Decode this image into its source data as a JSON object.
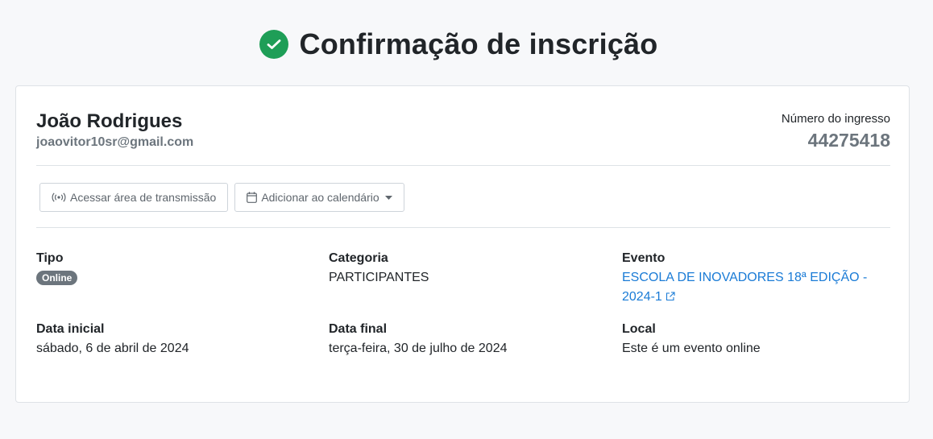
{
  "header": {
    "title": "Confirmação de inscrição",
    "success_color": "#1e9e57"
  },
  "user": {
    "name": "João Rodrigues",
    "email": "joaovitor10sr@gmail.com"
  },
  "ticket": {
    "label": "Número do ingresso",
    "number": "44275418"
  },
  "actions": {
    "stream_label": "Acessar área de transmissão",
    "stream_icon": "broadcast-icon",
    "calendar_label": "Adicionar ao calendário",
    "calendar_icon": "calendar-icon"
  },
  "details": {
    "tipo_label": "Tipo",
    "tipo_value": "Online",
    "categoria_label": "Categoria",
    "categoria_value": "PARTICIPANTES",
    "evento_label": "Evento",
    "evento_value": "ESCOLA DE INOVADORES 18ª EDIÇÃO - 2024-1",
    "data_inicial_label": "Data inicial",
    "data_inicial_value": "sábado, 6 de abril de 2024",
    "data_final_label": "Data final",
    "data_final_value": "terça-feira, 30 de julho de 2024",
    "local_label": "Local",
    "local_value": "Este é um evento online"
  }
}
